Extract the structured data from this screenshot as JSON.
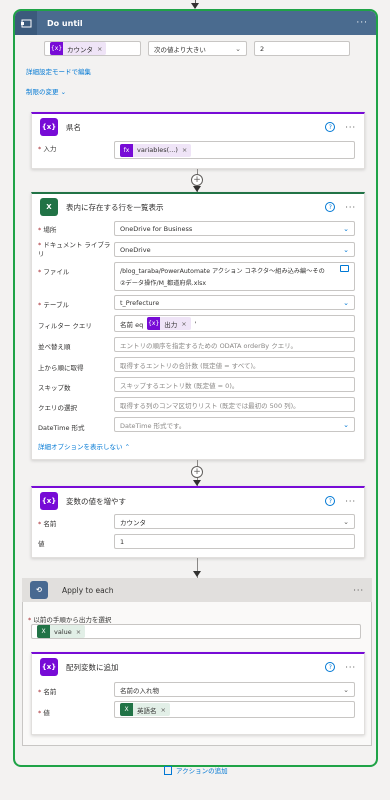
{
  "do_until": {
    "title": "Do until",
    "condition_token": "カウンタ",
    "operator": "次の値より大きい",
    "value": "2",
    "advanced_link": "詳細設定モードで編集",
    "limits_link": "制限の変更"
  },
  "prefecture_card": {
    "title": "県名",
    "input_label": "入力",
    "input_token": "variables(...)"
  },
  "excel_card": {
    "title": "表内に存在する行を一覧表示",
    "location_label": "場所",
    "location_value": "OneDrive for Business",
    "library_label": "ドキュメント ライブラリ",
    "library_value": "OneDrive",
    "file_label": "ファイル",
    "file_value_line1": "/blog_taraba/PowerAutomate アクション コネクタ～組み込み編～その",
    "file_value_line2": "②データ操作/M_都道府県.xlsx",
    "table_label": "テーブル",
    "table_value": "t_Prefecture",
    "filter_label": "フィルター クエリ",
    "filter_prefix": "名前 eq",
    "filter_token": "出力",
    "filter_suffix": "'",
    "orderby_label": "並べ替え順",
    "orderby_placeholder": "エントリの順序を指定するための ODATA orderBy クエリ。",
    "top_label": "上から順に取得",
    "top_placeholder": "取得するエントリの合計数 (既定値 = すべて)。",
    "skip_label": "スキップ数",
    "skip_placeholder": "スキップするエントリ数 (既定値 = 0)。",
    "select_label": "クエリの選択",
    "select_placeholder": "取得する列のコンマ区切りリスト (既定では最初の 500 列)。",
    "datetime_label": "DateTime 形式",
    "datetime_placeholder": "DateTime 形式です。",
    "hide_advanced": "詳細オプションを表示しない"
  },
  "increment_card": {
    "title": "変数の値を増やす",
    "name_label": "名前",
    "name_value": "カウンタ",
    "value_label": "値",
    "value_value": "1"
  },
  "apply_each": {
    "title": "Apply to each",
    "select_label": "以前の手順から出力を選択",
    "token": "value"
  },
  "append_card": {
    "title": "配列変数に追加",
    "name_label": "名前",
    "name_value": "名前の入れ物",
    "value_label": "値",
    "value_token": "英語名"
  },
  "add_action": "アクションの追加",
  "colors": {
    "frame": "#1fa347",
    "variable": "#770bd6",
    "excel": "#217346",
    "control": "#4a6b8f",
    "link": "#0078d4"
  }
}
